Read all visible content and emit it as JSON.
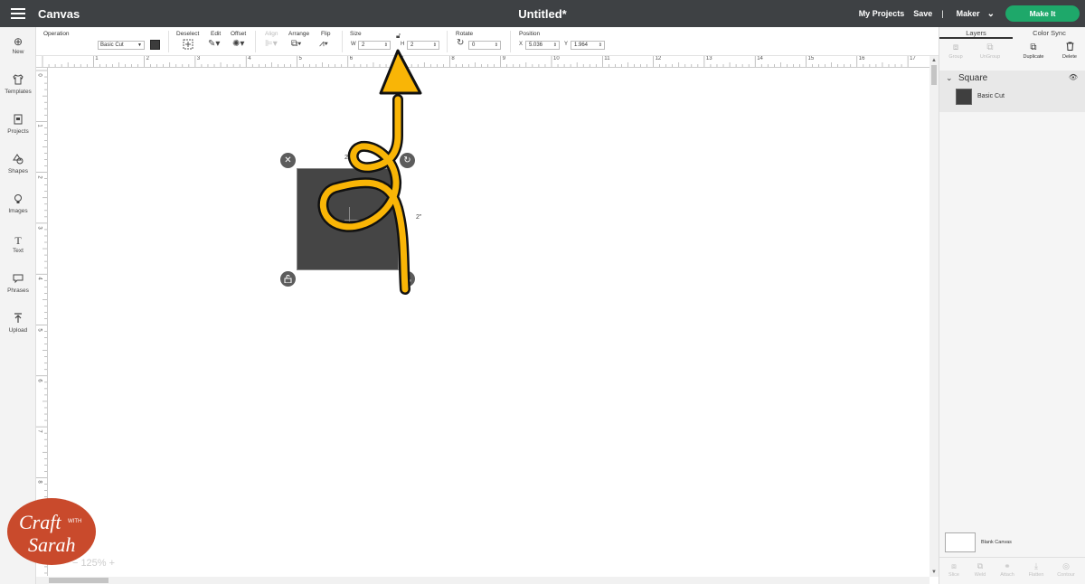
{
  "topbar": {
    "app_title": "Canvas",
    "document_title": "Untitled*",
    "my_projects": "My Projects",
    "save": "Save",
    "separator": "|",
    "machine": "Maker",
    "make_it": "Make It"
  },
  "left_toolbar": [
    {
      "label": "New",
      "icon": "plus-circle-icon"
    },
    {
      "label": "Templates",
      "icon": "shirt-icon"
    },
    {
      "label": "Projects",
      "icon": "projects-icon"
    },
    {
      "label": "Shapes",
      "icon": "shapes-icon"
    },
    {
      "label": "Images",
      "icon": "lightbulb-icon"
    },
    {
      "label": "Text",
      "icon": "text-icon"
    },
    {
      "label": "Phrases",
      "icon": "speech-bubble-icon"
    },
    {
      "label": "Upload",
      "icon": "upload-icon"
    }
  ],
  "editbar": {
    "operation_label": "Operation",
    "operation_value": "Basic Cut",
    "deselect_label": "Deselect",
    "edit_label": "Edit",
    "offset_label": "Offset",
    "align_label": "Align",
    "arrange_label": "Arrange",
    "flip_label": "Flip",
    "size_label": "Size",
    "width_prefix": "W",
    "width_value": "2",
    "height_prefix": "H",
    "height_value": "2",
    "rotate_label": "Rotate",
    "rotate_value": "0",
    "position_label": "Position",
    "x_prefix": "X",
    "x_value": "5.036",
    "y_prefix": "Y",
    "y_value": "1.964",
    "swatch_color": "#3c3c3c"
  },
  "right_panel": {
    "tabs": [
      "Layers",
      "Color Sync"
    ],
    "actions": [
      {
        "label": "Group",
        "enabled": false
      },
      {
        "label": "UnGroup",
        "enabled": false
      },
      {
        "label": "Duplicate",
        "enabled": true
      },
      {
        "label": "Delete",
        "enabled": true
      }
    ],
    "layer_group_name": "Square",
    "layer_item_label": "Basic Cut",
    "blank_canvas": "Blank Canvas",
    "bottom_actions": [
      "Slice",
      "Weld",
      "Attach",
      "Flatten",
      "Contour"
    ]
  },
  "rulers": {
    "top": [
      "1",
      "2",
      "3",
      "4",
      "5",
      "6",
      "7",
      "8",
      "9",
      "10",
      "11",
      "12",
      "13",
      "14",
      "15",
      "16",
      "17"
    ],
    "left": [
      "0",
      "1",
      "2",
      "3",
      "4",
      "5",
      "6",
      "7",
      "8",
      "9"
    ]
  },
  "canvas": {
    "shape_width_label": "2\"",
    "shape_height_label": "2\"",
    "zoom_level": "125%",
    "zoom_minus": "−",
    "zoom_plus": "+"
  },
  "watermark": {
    "line1": "Craft",
    "small": "WITH",
    "line2": "Sarah",
    "color": "#c94a2c"
  },
  "colors": {
    "topbar": "#3e4144",
    "make_it": "#1ea86a",
    "arrow": "#f9b506"
  }
}
